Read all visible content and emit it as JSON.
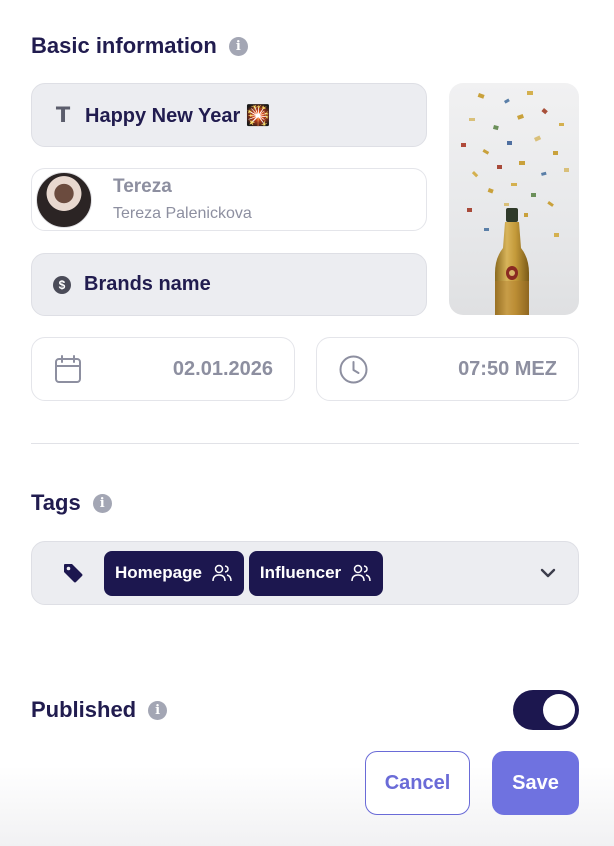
{
  "basic_info": {
    "heading": "Basic information",
    "title_value": "Happy New Year 🎇",
    "author_display": "Tereza",
    "author_fullname": "Tereza Palenickova",
    "brand_value": "Brands name",
    "date_value": "02.01.2026",
    "time_value": "07:50 MEZ"
  },
  "tags": {
    "heading": "Tags",
    "items": [
      {
        "label": "Homepage"
      },
      {
        "label": "Influencer"
      }
    ]
  },
  "published": {
    "label": "Published",
    "enabled": true
  },
  "actions": {
    "cancel_label": "Cancel",
    "save_label": "Save"
  },
  "colors": {
    "accent": "#6f72e0",
    "chip": "#1c174f",
    "field_gray": "#ecedf1"
  },
  "icons": [
    "info-icon",
    "text-icon",
    "dollar-icon",
    "calendar-icon",
    "clock-icon",
    "tag-icon",
    "users-icon",
    "chevron-down-icon"
  ]
}
